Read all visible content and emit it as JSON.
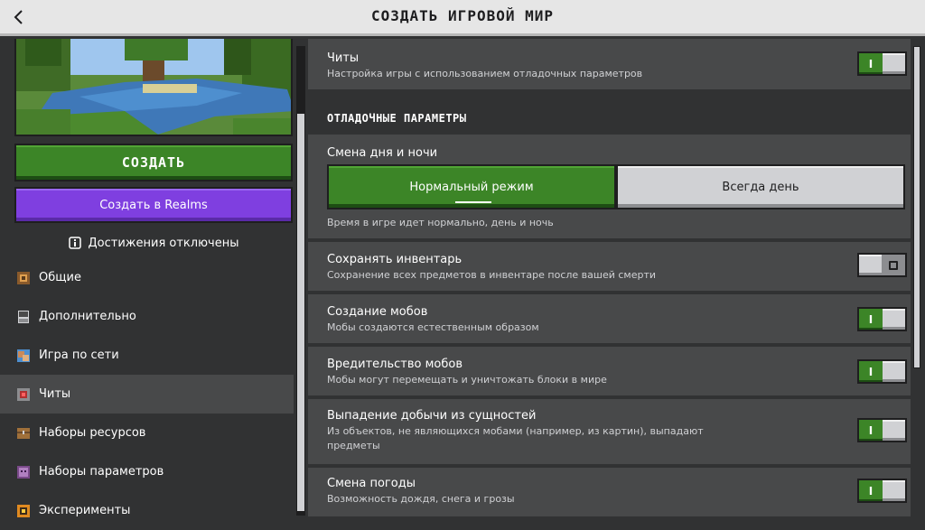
{
  "header": {
    "title": "СОЗДАТЬ ИГРОВОЙ МИР"
  },
  "left": {
    "create_label": "СОЗДАТЬ",
    "realms_label": "Создать в Realms",
    "achievements_notice": "Достижения отключены",
    "nav": [
      {
        "label": "Общие",
        "icon": "general-icon",
        "active": false
      },
      {
        "label": "Дополнительно",
        "icon": "advanced-icon",
        "active": false
      },
      {
        "label": "Игра по сети",
        "icon": "multiplayer-icon",
        "active": false
      },
      {
        "label": "Читы",
        "icon": "cheats-icon",
        "active": true
      },
      {
        "label": "Наборы ресурсов",
        "icon": "resource-packs-icon",
        "active": false
      },
      {
        "label": "Наборы параметров",
        "icon": "behavior-packs-icon",
        "active": false
      },
      {
        "label": "Эксперименты",
        "icon": "experiments-icon",
        "active": false
      }
    ]
  },
  "right": {
    "cheats": {
      "title": "Читы",
      "desc": "Настройка игры с использованием отладочных параметров",
      "on": true
    },
    "section_header": "ОТЛАДОЧНЫЕ ПАРАМЕТРЫ",
    "daylight": {
      "title": "Смена дня и ночи",
      "option_selected": "Нормальный режим",
      "option_other": "Всегда день",
      "desc": "Время в игре идет нормально, день и ночь"
    },
    "keep_inventory": {
      "title": "Сохранять инвентарь",
      "desc": "Сохранение всех предметов в инвентаре после вашей смерти",
      "on": false
    },
    "mob_spawning": {
      "title": "Создание мобов",
      "desc": "Мобы создаются естественным образом",
      "on": true
    },
    "mob_griefing": {
      "title": "Вредительство мобов",
      "desc": "Мобы могут перемещать и уничтожать блоки в мире",
      "on": true
    },
    "entity_drops": {
      "title": "Выпадение добычи из сущностей",
      "desc": "Из объектов, не являющихся мобами (например, из картин), выпадают предметы",
      "on": true
    },
    "weather": {
      "title": "Смена погоды",
      "desc": "Возможность дождя, снега и грозы",
      "on": true
    }
  },
  "colors": {
    "accent_green": "#3c8527",
    "realms_purple": "#7f3fe0",
    "panel": "#48494a",
    "background": "#313233"
  }
}
